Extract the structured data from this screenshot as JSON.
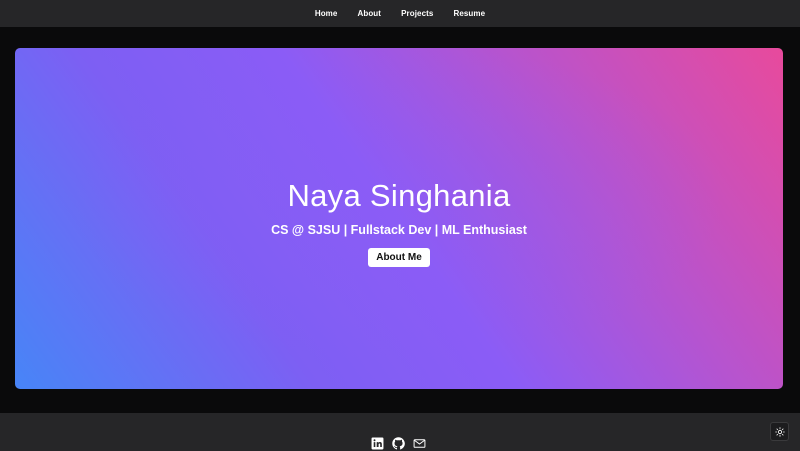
{
  "nav": {
    "items": [
      {
        "label": "Home"
      },
      {
        "label": "About"
      },
      {
        "label": "Projects"
      },
      {
        "label": "Resume"
      }
    ]
  },
  "hero": {
    "name": "Naya Singhania",
    "tagline": "CS @ SJSU | Fullstack Dev | ML Enthusiast",
    "button_label": "About Me",
    "gradient_colors": [
      "#4785f7",
      "#8b5cf6",
      "#e84a9c"
    ]
  },
  "footer": {
    "social": [
      {
        "icon": "linkedin-icon"
      },
      {
        "icon": "github-icon"
      },
      {
        "icon": "mail-icon"
      }
    ]
  },
  "theme_toggle": {
    "icon": "sun-icon"
  },
  "colors": {
    "page_background": "#0a0a0b",
    "bar_background": "#262628",
    "text": "#ffffff"
  }
}
